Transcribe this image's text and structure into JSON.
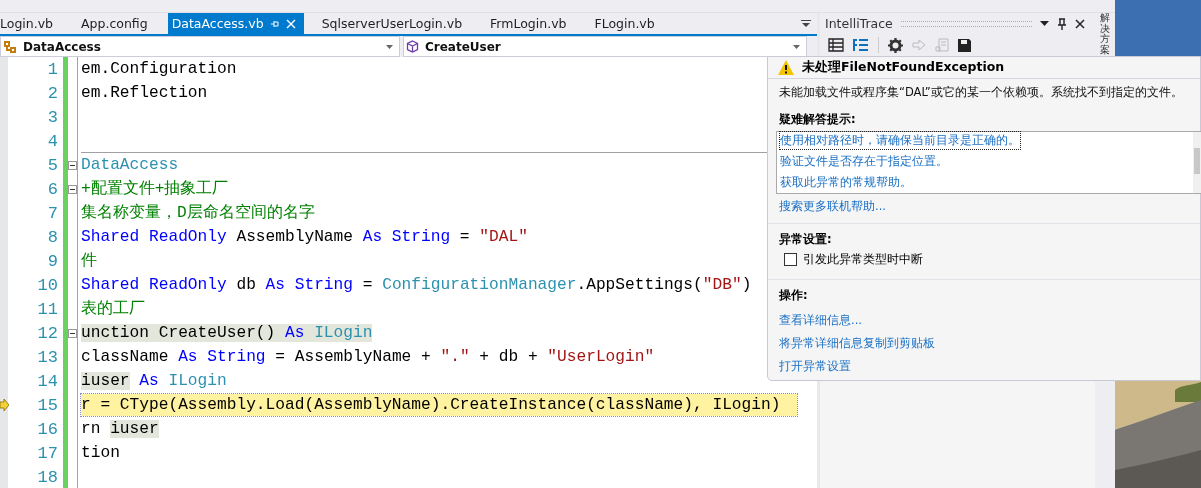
{
  "document_tabs": [
    {
      "label": "Login.vb",
      "selected": false
    },
    {
      "label": "App.config",
      "selected": false
    },
    {
      "label": "DataAccess.vb",
      "selected": true
    },
    {
      "label": "SqlserverUserLogin.vb",
      "selected": false
    },
    {
      "label": "FrmLogin.vb",
      "selected": false
    },
    {
      "label": "FLogin.vb",
      "selected": false
    }
  ],
  "navigation": {
    "type_dropdown": "DataAccess",
    "member_dropdown": "CreateUser"
  },
  "code_lines": [
    {
      "number": "1",
      "current": false,
      "tokens": [
        {
          "kind": "plain",
          "text": "em.Configuration",
          "highlighted": false
        }
      ]
    },
    {
      "number": "2",
      "current": false,
      "tokens": [
        {
          "kind": "plain",
          "text": "em.Reflection",
          "highlighted": false
        }
      ]
    },
    {
      "number": "3"
    },
    {
      "number": "4"
    },
    {
      "number": "5",
      "current": false,
      "collapsed": false,
      "tokens": [
        {
          "kind": "type",
          "text": "DataAccess",
          "highlighted": false
        }
      ]
    },
    {
      "number": "6",
      "current": false,
      "collapsed": false,
      "tokens": [
        {
          "kind": "comment",
          "text": "+配置文件+抽象工厂",
          "highlighted": false
        }
      ]
    },
    {
      "number": "7",
      "current": false,
      "tokens": [
        {
          "kind": "comment",
          "text": "集名称变量，D层命名空间的名字",
          "highlighted": false
        }
      ]
    },
    {
      "number": "8",
      "current": false,
      "tokens": [
        {
          "kind": "keyword",
          "text": "Shared ReadOnly",
          "highlighted": false
        },
        {
          "kind": "plain",
          "text": " AssemblyName ",
          "highlighted": false
        },
        {
          "kind": "keyword",
          "text": "As String",
          "highlighted": false
        },
        {
          "kind": "plain",
          "text": " = ",
          "highlighted": false
        },
        {
          "kind": "string",
          "text": "\"DAL\"",
          "highlighted": false
        }
      ]
    },
    {
      "number": "9",
      "current": false,
      "tokens": [
        {
          "kind": "comment",
          "text": "件",
          "highlighted": false
        }
      ]
    },
    {
      "number": "10",
      "current": false,
      "tokens": [
        {
          "kind": "keyword",
          "text": "Shared ReadOnly",
          "highlighted": false
        },
        {
          "kind": "plain",
          "text": " db ",
          "highlighted": false
        },
        {
          "kind": "keyword",
          "text": "As String",
          "highlighted": false
        },
        {
          "kind": "plain",
          "text": " = ",
          "highlighted": false
        },
        {
          "kind": "type",
          "text": "ConfigurationManager",
          "highlighted": false
        },
        {
          "kind": "plain",
          "text": ".AppSettings(",
          "highlighted": false
        },
        {
          "kind": "string",
          "text": "\"DB\"",
          "highlighted": false
        },
        {
          "kind": "plain",
          "text": ")",
          "highlighted": false
        }
      ]
    },
    {
      "number": "11",
      "current": false,
      "tokens": [
        {
          "kind": "comment",
          "text": "表的工厂",
          "highlighted": false
        }
      ]
    },
    {
      "number": "12",
      "current": false,
      "collapsed": false,
      "tokens": [
        {
          "kind": "plain",
          "text": "unction CreateUser() ",
          "highlighted": true
        },
        {
          "kind": "keyword",
          "text": "As ",
          "highlighted": true
        },
        {
          "kind": "type",
          "text": "ILogin",
          "highlighted": true
        }
      ]
    },
    {
      "number": "13",
      "current": false,
      "tokens": [
        {
          "kind": "plain",
          "text": "className ",
          "highlighted": false
        },
        {
          "kind": "keyword",
          "text": "As String",
          "highlighted": false
        },
        {
          "kind": "plain",
          "text": " = AssemblyName + ",
          "highlighted": false
        },
        {
          "kind": "string",
          "text": "\".\"",
          "highlighted": false
        },
        {
          "kind": "plain",
          "text": " + db + ",
          "highlighted": false
        },
        {
          "kind": "string",
          "text": "\"UserLogin\"",
          "highlighted": false
        }
      ]
    },
    {
      "number": "14",
      "current": false,
      "tokens": [
        {
          "kind": "plain",
          "text": "iuser",
          "highlighted": true
        },
        {
          "kind": "keyword",
          "text": " As ",
          "highlighted": false
        },
        {
          "kind": "type",
          "text": "ILogin",
          "highlighted": false
        }
      ]
    },
    {
      "number": "15",
      "current": true,
      "tokens": [
        {
          "kind": "plain",
          "text": "r = CType(Assembly.Load(AssemblyName).CreateInstance(className), ILogin)",
          "highlighted": false
        }
      ]
    },
    {
      "number": "16",
      "current": false,
      "tokens": [
        {
          "kind": "plain",
          "text": "rn ",
          "highlighted": false
        },
        {
          "kind": "plain",
          "text": "iuser",
          "highlighted": true
        }
      ]
    },
    {
      "number": "17",
      "current": false,
      "tokens": [
        {
          "kind": "plain",
          "text": "tion",
          "highlighted": false
        }
      ]
    },
    {
      "number": "18"
    }
  ],
  "intellitrace": {
    "title": "IntelliTrace"
  },
  "side_tab": "解决方案",
  "exception_popup": {
    "title": "未处理FileNotFoundException",
    "message": "未能加载文件或程序集“DAL”或它的某一个依赖项。系统找不到指定的文件。",
    "troubleshooting_heading": "疑难解答提示:",
    "tips": [
      {
        "text": "使用相对路径时，请确保当前目录是正确的。",
        "selected": true
      },
      {
        "text": "验证文件是否存在于指定位置。",
        "selected": false
      },
      {
        "text": "获取此异常的常规帮助。",
        "selected": false
      }
    ],
    "search_link": "搜索更多联机帮助...",
    "settings_heading": "异常设置:",
    "break_option": {
      "label": "引发此异常类型时中断",
      "checked": false
    },
    "actions_heading": "操作:",
    "actions": [
      "查看详细信息...",
      "将异常详细信息复制到剪贴板",
      "打开异常设置"
    ]
  }
}
